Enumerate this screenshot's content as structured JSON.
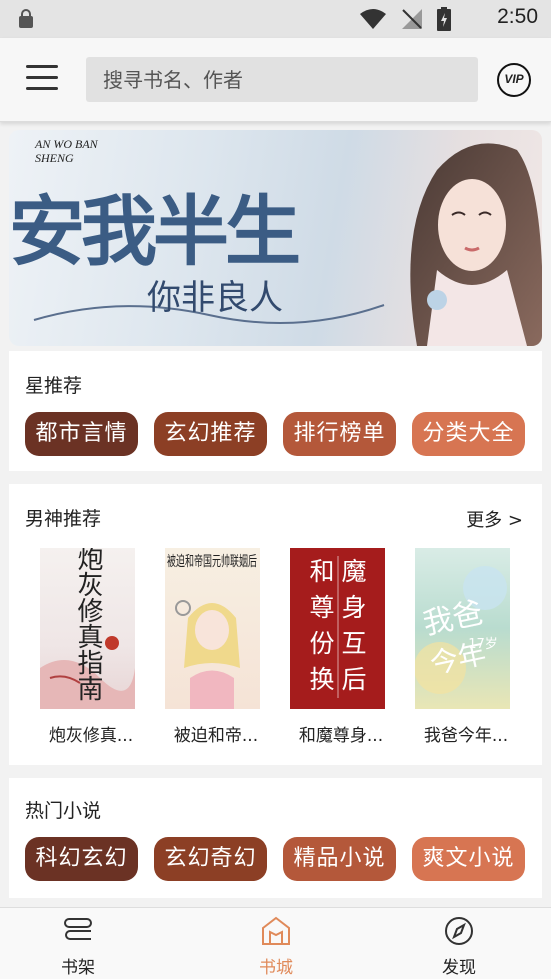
{
  "status_bar": {
    "time": "2:50"
  },
  "toolbar": {
    "search_placeholder": "搜寻书名、作者",
    "vip_label": "VIP"
  },
  "banner": {
    "english_title": "AN WO BAN SHENG",
    "title": "安我半生",
    "subtitle": "你非良人"
  },
  "star_section": {
    "title": "星推荐",
    "tags": [
      {
        "label": "都市言情",
        "color": "#6b3224"
      },
      {
        "label": "玄幻推荐",
        "color": "#8c3f25"
      },
      {
        "label": "排行榜单",
        "color": "#b4583a"
      },
      {
        "label": "分类大全",
        "color": "#d77552"
      }
    ]
  },
  "male_section": {
    "title": "男神推荐",
    "more_label": "更多 >",
    "books": [
      {
        "title": "炮灰修真..."
      },
      {
        "title": "被迫和帝..."
      },
      {
        "title": "和魔尊身..."
      },
      {
        "title": "我爸今年..."
      }
    ]
  },
  "hot_section": {
    "title": "热门小说",
    "tags": [
      {
        "label": "科幻玄幻",
        "color": "#6b3224"
      },
      {
        "label": "玄幻奇幻",
        "color": "#8c3f25"
      },
      {
        "label": "精品小说",
        "color": "#b4583a"
      },
      {
        "label": "爽文小说",
        "color": "#d77552"
      }
    ]
  },
  "bottom_nav": {
    "items": [
      {
        "label": "书架",
        "icon": "bookshelf-icon"
      },
      {
        "label": "书城",
        "icon": "bookstore-icon",
        "active": true
      },
      {
        "label": "发现",
        "icon": "compass-icon"
      }
    ],
    "active_color": "#e08a5a"
  },
  "covers": {
    "book1": {
      "text": "炮灰修真指南"
    },
    "book2": {
      "text": "被迫和帝国元帅联姻后"
    },
    "book3": {
      "text": "和魔尊身份互换"
    },
    "book4": {
      "text": "我爸今年17岁"
    }
  }
}
